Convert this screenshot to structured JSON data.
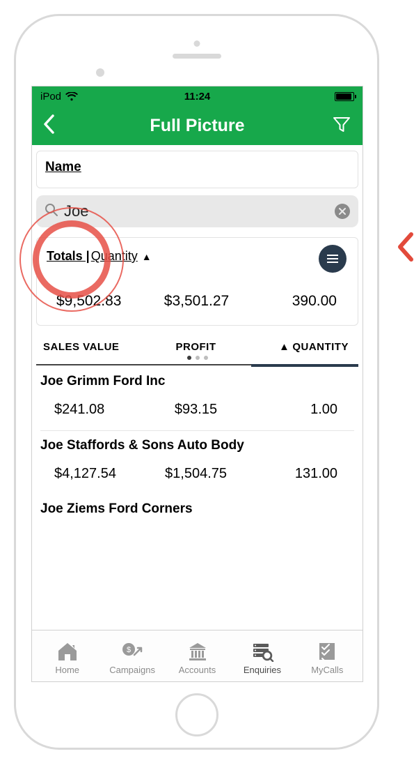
{
  "status": {
    "device": "iPod",
    "time": "11:24"
  },
  "header": {
    "title": "Full Picture"
  },
  "name_section": {
    "label": "Name"
  },
  "search": {
    "value": "Joe"
  },
  "totals": {
    "label_totals": "Totals |",
    "label_quantity": " Quantity",
    "sales_value": "$9,502.83",
    "profit": "$3,501.27",
    "quantity": "390.00"
  },
  "columns": {
    "sales_value": "SALES VALUE",
    "profit": "PROFIT",
    "quantity": "QUANTITY"
  },
  "rows": [
    {
      "name": "Joe Grimm Ford Inc",
      "sales_value": "$241.08",
      "profit": "$93.15",
      "quantity": "1.00"
    },
    {
      "name": "Joe Staffords & Sons Auto Body",
      "sales_value": "$4,127.54",
      "profit": "$1,504.75",
      "quantity": "131.00"
    },
    {
      "name": "Joe Ziems Ford Corners",
      "sales_value": "",
      "profit": "",
      "quantity": ""
    }
  ],
  "tabs": {
    "home": "Home",
    "campaigns": "Campaigns",
    "accounts": "Accounts",
    "enquiries": "Enquiries",
    "mycalls": "MyCalls"
  }
}
